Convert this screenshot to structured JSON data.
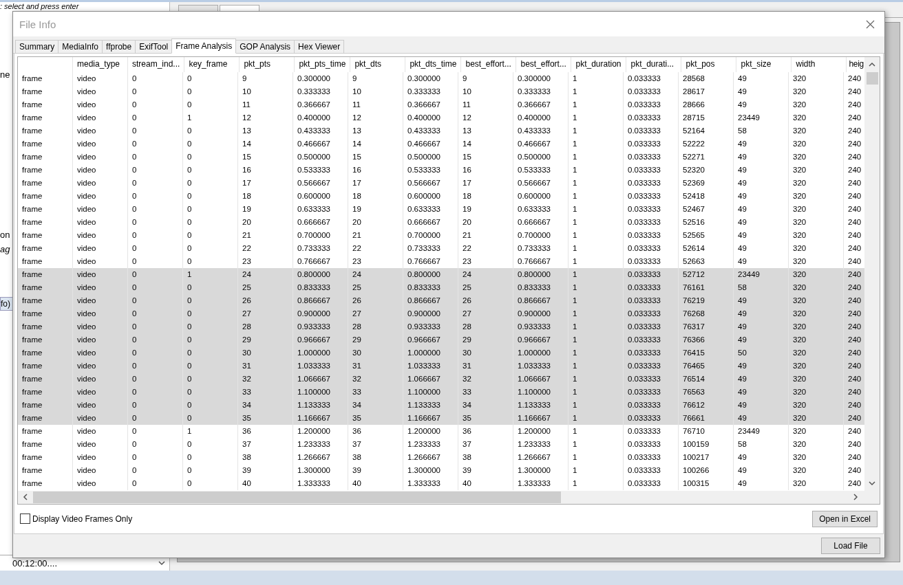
{
  "background": {
    "hint": ": select and press enter",
    "fragments": [
      {
        "text": "ne",
        "italic": false
      },
      {
        "text": "on",
        "italic": false
      },
      {
        "text": "ag",
        "italic": true
      }
    ],
    "panel_title": "fo)",
    "timecode": "00:12:00...."
  },
  "dialog": {
    "title": "File Info",
    "tabs": [
      {
        "label": "Summary",
        "selected": false
      },
      {
        "label": "MediaInfo",
        "selected": false
      },
      {
        "label": "ffprobe",
        "selected": false
      },
      {
        "label": "ExifTool",
        "selected": false
      },
      {
        "label": "Frame Analysis",
        "selected": true
      },
      {
        "label": "GOP Analysis",
        "selected": false
      },
      {
        "label": "Hex Viewer",
        "selected": false
      }
    ],
    "table": {
      "columns": [
        "",
        "media_type",
        "stream_ind...",
        "key_frame",
        "pkt_pts",
        "pkt_pts_time",
        "pkt_dts",
        "pkt_dts_time",
        "best_effort...",
        "best_effort...",
        "pkt_duration",
        "pkt_durati...",
        "pkt_pos",
        "pkt_size",
        "width",
        "heig"
      ],
      "rows": [
        {
          "selected": false,
          "cells": [
            "frame",
            "video",
            "0",
            "0",
            "9",
            "0.300000",
            "9",
            "0.300000",
            "9",
            "0.300000",
            "1",
            "0.033333",
            "28568",
            "49",
            "320",
            "240"
          ]
        },
        {
          "selected": false,
          "cells": [
            "frame",
            "video",
            "0",
            "0",
            "10",
            "0.333333",
            "10",
            "0.333333",
            "10",
            "0.333333",
            "1",
            "0.033333",
            "28617",
            "49",
            "320",
            "240"
          ]
        },
        {
          "selected": false,
          "cells": [
            "frame",
            "video",
            "0",
            "0",
            "11",
            "0.366667",
            "11",
            "0.366667",
            "11",
            "0.366667",
            "1",
            "0.033333",
            "28666",
            "49",
            "320",
            "240"
          ]
        },
        {
          "selected": false,
          "cells": [
            "frame",
            "video",
            "0",
            "1",
            "12",
            "0.400000",
            "12",
            "0.400000",
            "12",
            "0.400000",
            "1",
            "0.033333",
            "28715",
            "23449",
            "320",
            "240"
          ]
        },
        {
          "selected": false,
          "cells": [
            "frame",
            "video",
            "0",
            "0",
            "13",
            "0.433333",
            "13",
            "0.433333",
            "13",
            "0.433333",
            "1",
            "0.033333",
            "52164",
            "58",
            "320",
            "240"
          ]
        },
        {
          "selected": false,
          "cells": [
            "frame",
            "video",
            "0",
            "0",
            "14",
            "0.466667",
            "14",
            "0.466667",
            "14",
            "0.466667",
            "1",
            "0.033333",
            "52222",
            "49",
            "320",
            "240"
          ]
        },
        {
          "selected": false,
          "cells": [
            "frame",
            "video",
            "0",
            "0",
            "15",
            "0.500000",
            "15",
            "0.500000",
            "15",
            "0.500000",
            "1",
            "0.033333",
            "52271",
            "49",
            "320",
            "240"
          ]
        },
        {
          "selected": false,
          "cells": [
            "frame",
            "video",
            "0",
            "0",
            "16",
            "0.533333",
            "16",
            "0.533333",
            "16",
            "0.533333",
            "1",
            "0.033333",
            "52320",
            "49",
            "320",
            "240"
          ]
        },
        {
          "selected": false,
          "cells": [
            "frame",
            "video",
            "0",
            "0",
            "17",
            "0.566667",
            "17",
            "0.566667",
            "17",
            "0.566667",
            "1",
            "0.033333",
            "52369",
            "49",
            "320",
            "240"
          ]
        },
        {
          "selected": false,
          "cells": [
            "frame",
            "video",
            "0",
            "0",
            "18",
            "0.600000",
            "18",
            "0.600000",
            "18",
            "0.600000",
            "1",
            "0.033333",
            "52418",
            "49",
            "320",
            "240"
          ]
        },
        {
          "selected": false,
          "cells": [
            "frame",
            "video",
            "0",
            "0",
            "19",
            "0.633333",
            "19",
            "0.633333",
            "19",
            "0.633333",
            "1",
            "0.033333",
            "52467",
            "49",
            "320",
            "240"
          ]
        },
        {
          "selected": false,
          "cells": [
            "frame",
            "video",
            "0",
            "0",
            "20",
            "0.666667",
            "20",
            "0.666667",
            "20",
            "0.666667",
            "1",
            "0.033333",
            "52516",
            "49",
            "320",
            "240"
          ]
        },
        {
          "selected": false,
          "cells": [
            "frame",
            "video",
            "0",
            "0",
            "21",
            "0.700000",
            "21",
            "0.700000",
            "21",
            "0.700000",
            "1",
            "0.033333",
            "52565",
            "49",
            "320",
            "240"
          ]
        },
        {
          "selected": false,
          "cells": [
            "frame",
            "video",
            "0",
            "0",
            "22",
            "0.733333",
            "22",
            "0.733333",
            "22",
            "0.733333",
            "1",
            "0.033333",
            "52614",
            "49",
            "320",
            "240"
          ]
        },
        {
          "selected": false,
          "cells": [
            "frame",
            "video",
            "0",
            "0",
            "23",
            "0.766667",
            "23",
            "0.766667",
            "23",
            "0.766667",
            "1",
            "0.033333",
            "52663",
            "49",
            "320",
            "240"
          ]
        },
        {
          "selected": true,
          "cells": [
            "frame",
            "video",
            "0",
            "1",
            "24",
            "0.800000",
            "24",
            "0.800000",
            "24",
            "0.800000",
            "1",
            "0.033333",
            "52712",
            "23449",
            "320",
            "240"
          ]
        },
        {
          "selected": true,
          "cells": [
            "frame",
            "video",
            "0",
            "0",
            "25",
            "0.833333",
            "25",
            "0.833333",
            "25",
            "0.833333",
            "1",
            "0.033333",
            "76161",
            "58",
            "320",
            "240"
          ]
        },
        {
          "selected": true,
          "cells": [
            "frame",
            "video",
            "0",
            "0",
            "26",
            "0.866667",
            "26",
            "0.866667",
            "26",
            "0.866667",
            "1",
            "0.033333",
            "76219",
            "49",
            "320",
            "240"
          ]
        },
        {
          "selected": true,
          "cells": [
            "frame",
            "video",
            "0",
            "0",
            "27",
            "0.900000",
            "27",
            "0.900000",
            "27",
            "0.900000",
            "1",
            "0.033333",
            "76268",
            "49",
            "320",
            "240"
          ]
        },
        {
          "selected": true,
          "cells": [
            "frame",
            "video",
            "0",
            "0",
            "28",
            "0.933333",
            "28",
            "0.933333",
            "28",
            "0.933333",
            "1",
            "0.033333",
            "76317",
            "49",
            "320",
            "240"
          ]
        },
        {
          "selected": true,
          "cells": [
            "frame",
            "video",
            "0",
            "0",
            "29",
            "0.966667",
            "29",
            "0.966667",
            "29",
            "0.966667",
            "1",
            "0.033333",
            "76366",
            "49",
            "320",
            "240"
          ]
        },
        {
          "selected": true,
          "cells": [
            "frame",
            "video",
            "0",
            "0",
            "30",
            "1.000000",
            "30",
            "1.000000",
            "30",
            "1.000000",
            "1",
            "0.033333",
            "76415",
            "50",
            "320",
            "240"
          ]
        },
        {
          "selected": true,
          "cells": [
            "frame",
            "video",
            "0",
            "0",
            "31",
            "1.033333",
            "31",
            "1.033333",
            "31",
            "1.033333",
            "1",
            "0.033333",
            "76465",
            "49",
            "320",
            "240"
          ]
        },
        {
          "selected": true,
          "cells": [
            "frame",
            "video",
            "0",
            "0",
            "32",
            "1.066667",
            "32",
            "1.066667",
            "32",
            "1.066667",
            "1",
            "0.033333",
            "76514",
            "49",
            "320",
            "240"
          ]
        },
        {
          "selected": true,
          "cells": [
            "frame",
            "video",
            "0",
            "0",
            "33",
            "1.100000",
            "33",
            "1.100000",
            "33",
            "1.100000",
            "1",
            "0.033333",
            "76563",
            "49",
            "320",
            "240"
          ]
        },
        {
          "selected": true,
          "cells": [
            "frame",
            "video",
            "0",
            "0",
            "34",
            "1.133333",
            "34",
            "1.133333",
            "34",
            "1.133333",
            "1",
            "0.033333",
            "76612",
            "49",
            "320",
            "240"
          ]
        },
        {
          "selected": true,
          "cells": [
            "frame",
            "video",
            "0",
            "0",
            "35",
            "1.166667",
            "35",
            "1.166667",
            "35",
            "1.166667",
            "1",
            "0.033333",
            "76661",
            "49",
            "320",
            "240"
          ]
        },
        {
          "selected": false,
          "cells": [
            "frame",
            "video",
            "0",
            "1",
            "36",
            "1.200000",
            "36",
            "1.200000",
            "36",
            "1.200000",
            "1",
            "0.033333",
            "76710",
            "23449",
            "320",
            "240"
          ]
        },
        {
          "selected": false,
          "cells": [
            "frame",
            "video",
            "0",
            "0",
            "37",
            "1.233333",
            "37",
            "1.233333",
            "37",
            "1.233333",
            "1",
            "0.033333",
            "100159",
            "58",
            "320",
            "240"
          ]
        },
        {
          "selected": false,
          "cells": [
            "frame",
            "video",
            "0",
            "0",
            "38",
            "1.266667",
            "38",
            "1.266667",
            "38",
            "1.266667",
            "1",
            "0.033333",
            "100217",
            "49",
            "320",
            "240"
          ]
        },
        {
          "selected": false,
          "cells": [
            "frame",
            "video",
            "0",
            "0",
            "39",
            "1.300000",
            "39",
            "1.300000",
            "39",
            "1.300000",
            "1",
            "0.033333",
            "100266",
            "49",
            "320",
            "240"
          ]
        },
        {
          "selected": false,
          "cells": [
            "frame",
            "video",
            "0",
            "0",
            "40",
            "1.333333",
            "40",
            "1.333333",
            "40",
            "1.333333",
            "1",
            "0.033333",
            "100315",
            "49",
            "320",
            "240"
          ]
        }
      ]
    },
    "video_only": {
      "label": "Display Video Frames Only",
      "checked": false
    },
    "buttons": {
      "excel": "Open in Excel",
      "load": "Load File"
    }
  }
}
